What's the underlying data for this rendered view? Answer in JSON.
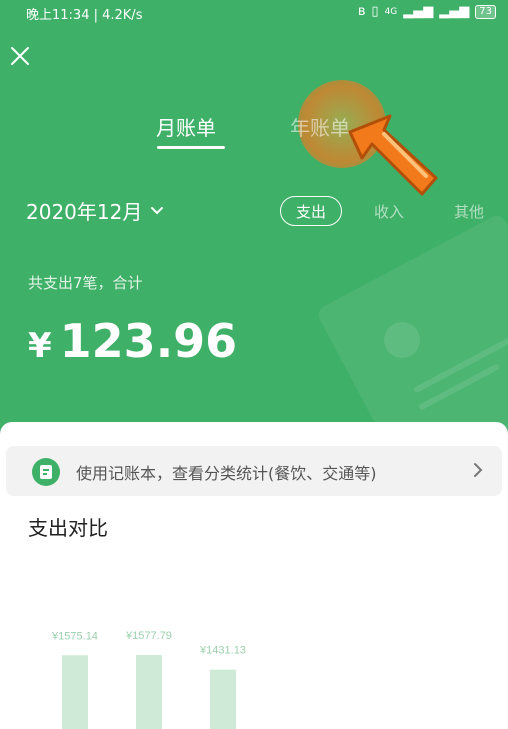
{
  "status_bar": {
    "left_text": "晚上11:34 | 4.2K/s",
    "network": "4G",
    "battery": "73"
  },
  "tabs": {
    "month": "月账单",
    "year": "年账单"
  },
  "period": {
    "label": "2020年12月"
  },
  "filters": {
    "expense": "支出",
    "income": "收入",
    "other": "其他"
  },
  "summary": {
    "text": "共支出7笔，合计",
    "currency": "¥",
    "amount": "123.96"
  },
  "banner": {
    "text": "使用记账本，查看分类统计(餐饮、交通等)"
  },
  "comparison": {
    "title": "支出对比"
  },
  "colors": {
    "primary": "#3fb068",
    "bar": "#cfebd8",
    "bar_label": "#9ad0ae"
  },
  "chart_data": {
    "type": "bar",
    "values": [
      1575.14,
      1577.79,
      1431.13
    ],
    "data_labels": [
      "¥1575.14",
      "¥1577.79",
      "¥1431.13"
    ],
    "title": "支出对比"
  }
}
